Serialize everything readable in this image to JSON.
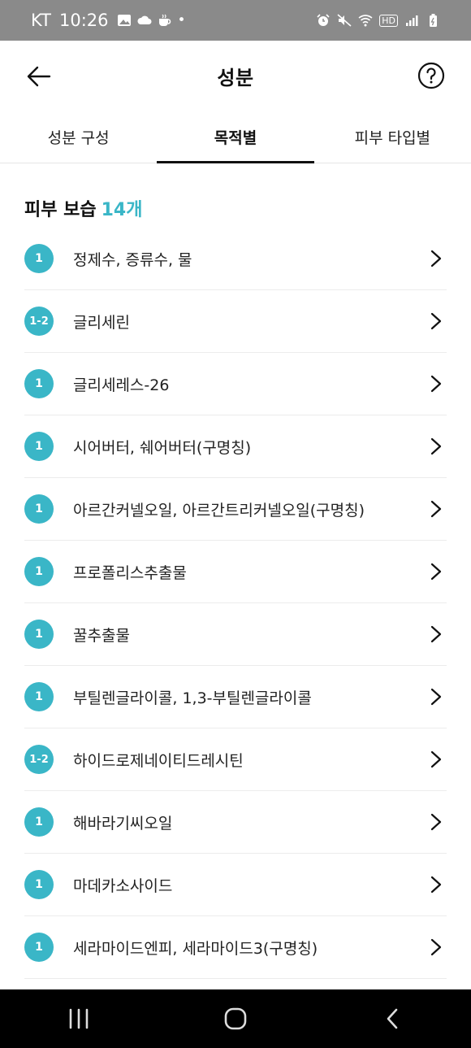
{
  "status_bar": {
    "carrier": "KT",
    "time": "10:26",
    "dot": "•",
    "hd": "HD",
    "left_icons": [
      "gallery-icon",
      "cloud-icon",
      "coffee-icon"
    ],
    "right_icons": [
      "alarm-icon",
      "mute-icon",
      "wifi-icon",
      "hd-icon",
      "signal-icon",
      "battery-icon"
    ]
  },
  "header": {
    "title": "성분"
  },
  "tabs": [
    {
      "label": "성분 구성",
      "active": false
    },
    {
      "label": "목적별",
      "active": true
    },
    {
      "label": "피부 타입별",
      "active": false
    }
  ],
  "section": {
    "title": "피부 보습",
    "count": "14개"
  },
  "ingredients": [
    {
      "grade": "1",
      "name": "정제수, 증류수, 물"
    },
    {
      "grade": "1-2",
      "name": "글리세린"
    },
    {
      "grade": "1",
      "name": "글리세레스-26"
    },
    {
      "grade": "1",
      "name": "시어버터, 쉐어버터(구명칭)"
    },
    {
      "grade": "1",
      "name": "아르간커넬오일, 아르간트리커넬오일(구명칭)"
    },
    {
      "grade": "1",
      "name": "프로폴리스추출물"
    },
    {
      "grade": "1",
      "name": "꿀추출물"
    },
    {
      "grade": "1",
      "name": "부틸렌글라이콜, 1,3-부틸렌글라이콜"
    },
    {
      "grade": "1-2",
      "name": "하이드로제네이티드레시틴"
    },
    {
      "grade": "1",
      "name": "해바라기씨오일"
    },
    {
      "grade": "1",
      "name": "마데카소사이드"
    },
    {
      "grade": "1",
      "name": "세라마이드엔피, 세라마이드3(구명칭)"
    }
  ],
  "colors": {
    "accent": "#3ab6c7",
    "status_bar": "#8a8a8a",
    "nav_bar": "#000000"
  }
}
